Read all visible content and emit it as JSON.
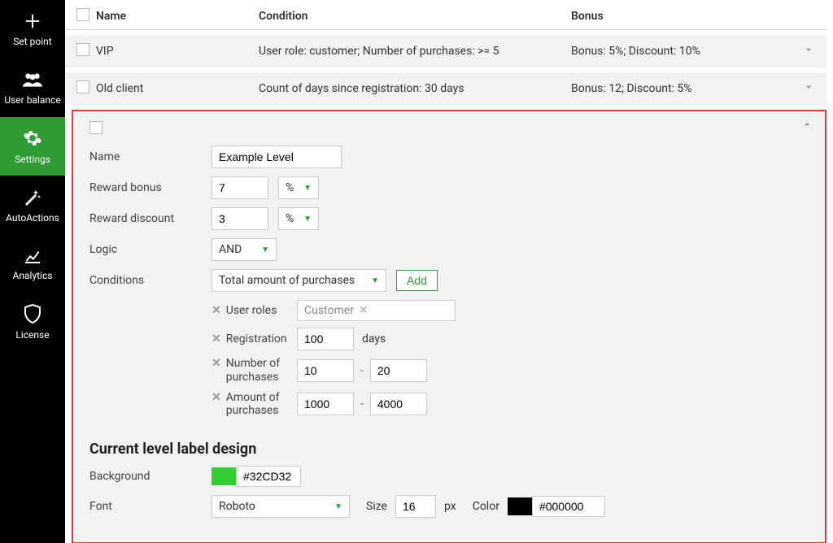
{
  "sidebar": [
    {
      "label": "Set point",
      "icon": "plus-icon"
    },
    {
      "label": "User balance",
      "icon": "users-icon"
    },
    {
      "label": "Settings",
      "icon": "gear-icon",
      "active": true
    },
    {
      "label": "AutoActions",
      "icon": "wand-icon"
    },
    {
      "label": "Analytics",
      "icon": "chart-icon"
    },
    {
      "label": "License",
      "icon": "shield-icon"
    }
  ],
  "table": {
    "headers": {
      "name": "Name",
      "condition": "Condition",
      "bonus": "Bonus"
    },
    "rows": [
      {
        "name": "VIP",
        "condition": "User role: customer; Number of purchases: >= 5",
        "bonus": "Bonus: 5%; Discount: 10%"
      },
      {
        "name": "Old client",
        "condition": "Count of days since registration: 30 days",
        "bonus": "Bonus: 12; Discount: 5%"
      }
    ]
  },
  "form": {
    "name_label": "Name",
    "name_value": "Example Level",
    "reward_bonus_label": "Reward bonus",
    "reward_bonus_value": "7",
    "reward_discount_label": "Reward discount",
    "reward_discount_value": "3",
    "percent": "%",
    "logic_label": "Logic",
    "logic_value": "AND",
    "conditions_label": "Conditions",
    "condition_select": "Total amount of purchases",
    "add_btn": "Add",
    "cond_userroles": "User roles",
    "tag_customer": "Customer",
    "cond_reg": "Registration",
    "reg_value": "100",
    "days": "days",
    "cond_np": "Number of purchases",
    "np_from": "10",
    "np_to": "20",
    "cond_ap": "Amount of purchases",
    "ap_from": "1000",
    "ap_to": "4000",
    "dash": "-"
  },
  "design": {
    "title": "Current level label design",
    "bg_label": "Background",
    "bg_color": "#32CD32",
    "font_label": "Font",
    "font_value": "Roboto",
    "size_label": "Size",
    "size_value": "16",
    "px": "px",
    "color_label": "Color",
    "color_value": "#000000"
  }
}
